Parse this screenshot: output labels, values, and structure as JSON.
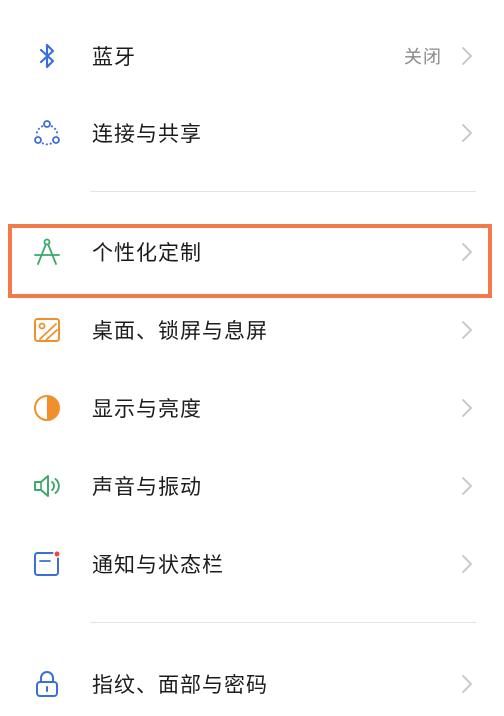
{
  "settings": {
    "items": [
      {
        "id": "bluetooth",
        "label": "蓝牙",
        "value": "关闭",
        "icon": "bluetooth-icon",
        "icon_color": "#3b6fd8"
      },
      {
        "id": "connection",
        "label": "连接与共享",
        "icon": "share-connection-icon",
        "icon_color": "#3b6fd8"
      },
      {
        "id": "personalization",
        "label": "个性化定制",
        "icon": "compass-icon",
        "icon_color": "#3aa86a"
      },
      {
        "id": "desktop",
        "label": "桌面、锁屏与息屏",
        "icon": "wallpaper-icon",
        "icon_color": "#f0902c"
      },
      {
        "id": "display",
        "label": "显示与亮度",
        "icon": "brightness-icon",
        "icon_color": "#f0902c"
      },
      {
        "id": "sound",
        "label": "声音与振动",
        "icon": "speaker-icon",
        "icon_color": "#3aa86a"
      },
      {
        "id": "notification",
        "label": "通知与状态栏",
        "icon": "notification-icon",
        "icon_color": "#3b6fd8"
      },
      {
        "id": "security",
        "label": "指纹、面部与密码",
        "icon": "lock-icon",
        "icon_color": "#3b6fd8"
      }
    ]
  },
  "highlight_color": "#f07a49",
  "chevron_color": "#c4c4c4"
}
